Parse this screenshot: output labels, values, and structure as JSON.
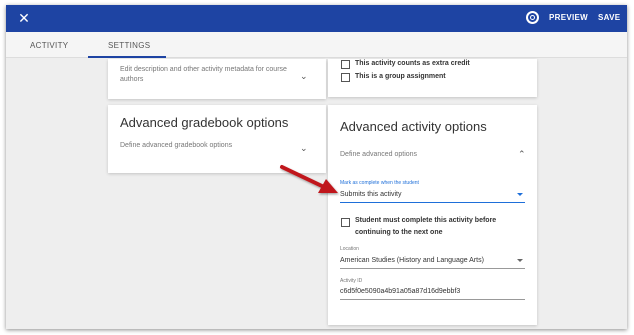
{
  "topbar": {
    "close_icon": "close-icon",
    "globe_icon": "globe-icon",
    "preview_label": "PREVIEW",
    "save_label": "SAVE",
    "color": "#1e44a3"
  },
  "tabs": [
    {
      "label": "ACTIVITY",
      "active": false
    },
    {
      "label": "SETTINGS",
      "active": true
    }
  ],
  "description_card": {
    "text": "Edit description and other activity metadata for course authors",
    "icon": "chevron-down-icon"
  },
  "gradebook_card": {
    "title": "Advanced gradebook options",
    "subtitle": "Define advanced gradebook options",
    "icon": "chevron-down-icon"
  },
  "assignment_options": {
    "extra_credit_label": "This activity counts as extra credit",
    "extra_credit_checked": false,
    "group_label": "This is a group assignment",
    "group_checked": false
  },
  "activity_options_card": {
    "title": "Advanced activity options",
    "subtitle": "Define advanced options",
    "icon": "chevron-up-icon",
    "completion_field": {
      "label": "Mark as complete when the student",
      "value": "Submits this activity"
    },
    "must_complete": {
      "label": "Student must complete this activity before continuing to the next one",
      "checked": false
    },
    "location_field": {
      "label": "Location",
      "value": "American Studies (History and Language Arts)"
    },
    "activity_id_field": {
      "label": "Activity ID",
      "value": "c6d5f0e5090a4b91a05a87d16d9ebbf3"
    }
  },
  "annotation": {
    "type": "red-arrow",
    "color": "#c0181c"
  }
}
